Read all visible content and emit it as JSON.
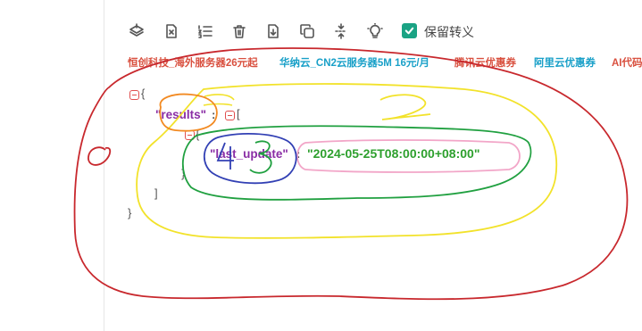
{
  "toolbar": {
    "buttons": [
      {
        "name": "layers-icon"
      },
      {
        "name": "file-x-icon"
      },
      {
        "name": "list-ordered-icon"
      },
      {
        "name": "trash-icon"
      },
      {
        "name": "file-download-icon"
      },
      {
        "name": "copy-icon"
      },
      {
        "name": "compress-icon"
      },
      {
        "name": "lightbulb-icon"
      }
    ],
    "keep_escape_label": "保留转义",
    "keep_escape_checked": true
  },
  "ads": [
    {
      "text": "恒创科技_海外服务器26元起",
      "color": "#d9503f"
    },
    {
      "text": "华纳云_CN2云服务器5M 16元/月",
      "color": "#19a0c8"
    },
    {
      "text": "腾讯云优惠券",
      "color": "#d9503f"
    },
    {
      "text": "阿里云优惠券",
      "color": "#19a0c8"
    },
    {
      "text": "AI代码",
      "color": "#d9503f"
    }
  ],
  "json_view": {
    "open_brace": "{",
    "results_key": "\"results\"",
    "colon": ":",
    "open_bracket": "[",
    "inner_open": "{",
    "last_update_key": "\"last_update\"",
    "last_update_value": "\"2024-05-25T08:00:00+08:00\"",
    "inner_close": "}",
    "close_bracket": "]",
    "close_brace": "}"
  },
  "annotations": {
    "label_1": "1",
    "label_2": "2",
    "label_3": "3",
    "label_4": "4"
  }
}
